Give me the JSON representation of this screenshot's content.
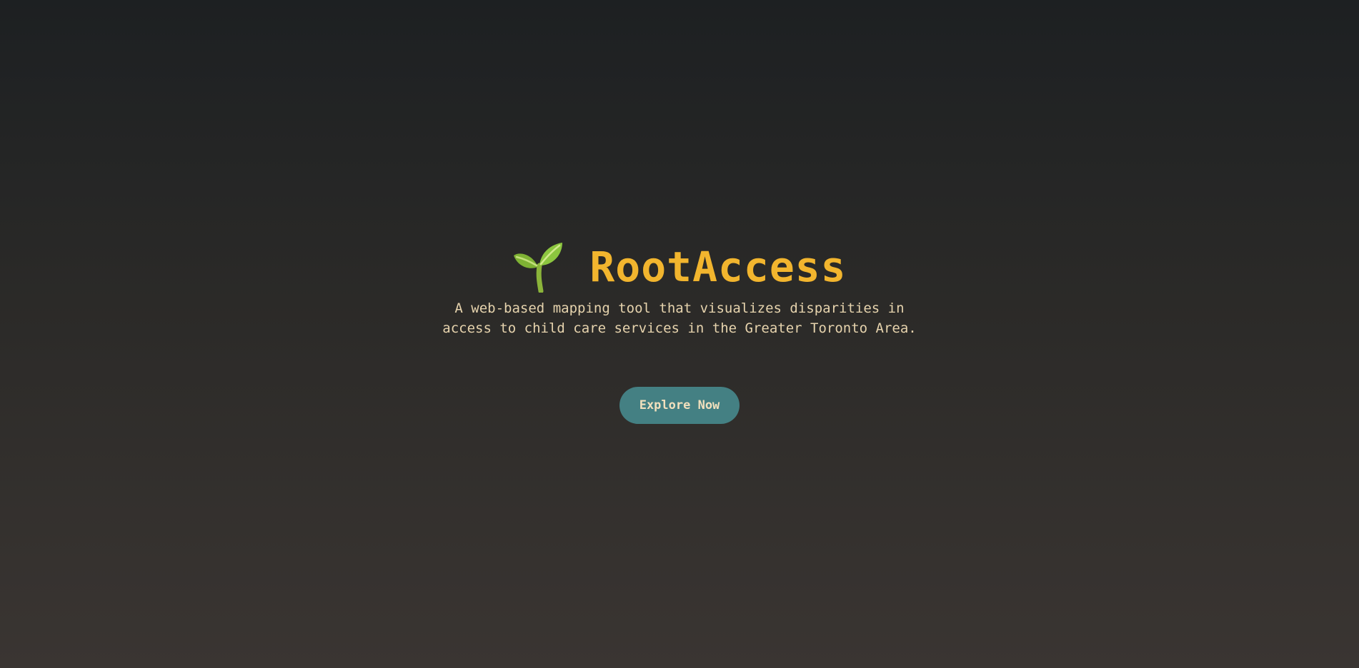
{
  "hero": {
    "icon": "sprout-icon",
    "title": "RootAccess",
    "description": "A web-based mapping tool that visualizes disparities in access to child care services in the Greater Toronto Area.",
    "cta_label": "Explore Now"
  },
  "colors": {
    "title": "#f2b52e",
    "description": "#e6d3ad",
    "button_bg": "#448083",
    "button_text": "#f1e0bd",
    "background_top": "#1d2022",
    "background_bottom": "#3a3532"
  }
}
